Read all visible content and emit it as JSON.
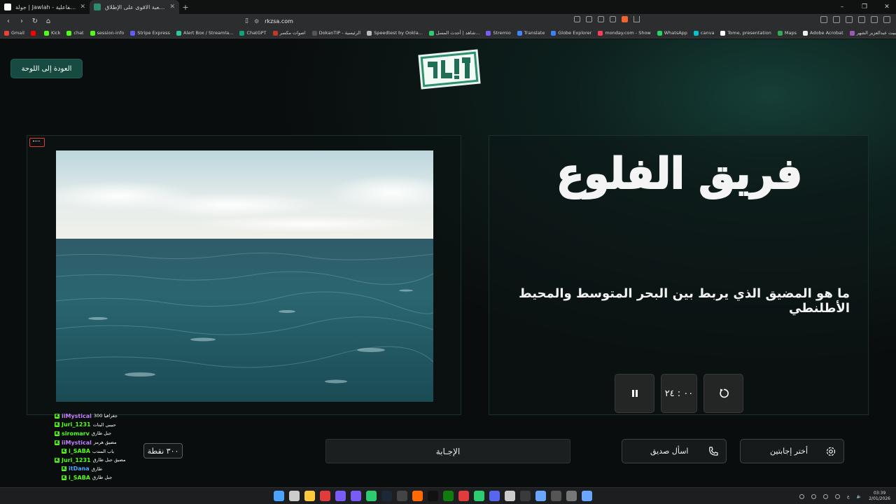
{
  "browser": {
    "tabs": [
      {
        "title": "جولة | Jawlah - منصة الألعاب التفاعلية",
        "active": false,
        "favicon_color": "#ffffff"
      },
      {
        "title": "ركز - اللعبة الاقوى على الإطلاق",
        "active": true,
        "favicon_color": "#2e8b6b"
      }
    ],
    "new_tab": "+",
    "window_controls": [
      "–",
      "❐",
      "✕"
    ],
    "url": "rkzsa.com",
    "bookmarks": [
      {
        "label": "Gmail",
        "color": "#ea4335"
      },
      {
        "label": "",
        "color": "#ff0000"
      },
      {
        "label": "Kick",
        "color": "#53fc18"
      },
      {
        "label": "chat",
        "color": "#53fc18"
      },
      {
        "label": "session-info",
        "color": "#53fc18"
      },
      {
        "label": "Stripe Express",
        "color": "#635bff"
      },
      {
        "label": "Alert Box / Streamla...",
        "color": "#31c3a2"
      },
      {
        "label": "ChatGPT",
        "color": "#10a37f"
      },
      {
        "label": "اصوات مكسر",
        "color": "#c0392b"
      },
      {
        "label": "DokanTIP - الرئيسية",
        "color": "#555555"
      },
      {
        "label": "Speedtest by Ookla...",
        "color": "#bbbbbb"
      },
      {
        "label": "شاهد | أحدث المسل...",
        "color": "#2ecc71"
      },
      {
        "label": "Stremio",
        "color": "#7b5bf5"
      },
      {
        "label": "Translate",
        "color": "#4285f4"
      },
      {
        "label": "Globe Explorer",
        "color": "#3b82f6"
      },
      {
        "label": "monday.com - Show",
        "color": "#ff3d57"
      },
      {
        "label": "WhatsApp",
        "color": "#25d366"
      },
      {
        "label": "canva",
        "color": "#00c4cc"
      },
      {
        "label": "Tome, presentation",
        "color": "#ffffff"
      },
      {
        "label": "Maps",
        "color": "#34a853"
      },
      {
        "label": "Adobe Acrobat",
        "color": "#eeeeee"
      },
      {
        "label": "البيت عبدالعزيز الشهر...",
        "color": "#9b59b6"
      }
    ]
  },
  "page": {
    "back_button": "العودة إلى اللوحة",
    "logo_text": "ركز!",
    "team_name": "فريق الفلوع",
    "question": "ما هو المضيق الذي يربط بين البحر المتوسط والمحيط الأطلنطي",
    "timer": "٠٠ : ٢٤",
    "answer_label": "الإجـابة",
    "ask_friend_label": "اسأل صديق",
    "two_answers_label": "أختر إجابتين",
    "score": "٣٠٠ نقطة"
  },
  "chat": [
    {
      "user": "iiMystical",
      "color": "#c77dff",
      "msg": "جغرافيا 300",
      "indent": 0
    },
    {
      "user": "Juri_1231",
      "color": "#53fc18",
      "msg": "حبيبي البنات",
      "indent": 0
    },
    {
      "user": "siromarv",
      "color": "#53fc18",
      "msg": "جبل طارق",
      "indent": 0
    },
    {
      "user": "iiMystical",
      "color": "#c77dff",
      "msg": "مضيق هرمز",
      "indent": 0
    },
    {
      "user": "i_SABA",
      "color": "#53fc18",
      "msg": "باب المندب",
      "indent": 10
    },
    {
      "user": "Juri_1231",
      "color": "#53fc18",
      "msg": "مضيق جبل طارق",
      "indent": 0
    },
    {
      "user": "itDana",
      "color": "#4fa3ff",
      "msg": "طارق",
      "indent": 10
    },
    {
      "user": "i_SABA",
      "color": "#53fc18",
      "msg": "جبل طارق",
      "indent": 10
    }
  ],
  "taskbar": {
    "icon_colors": [
      "#4aa3ff",
      "#cccccc",
      "#ffc83d",
      "#e23b3b",
      "#7b5bf5",
      "#7b5bf5",
      "#2ecc71",
      "#1b2838",
      "#444444",
      "#ff6b00",
      "#111111",
      "#107c10",
      "#e23b3b",
      "#2ecc71",
      "#5865f2",
      "#cccccc",
      "#3a3a3a",
      "#6aa6ff",
      "#555555",
      "#777777",
      "#6aa6ff"
    ],
    "lang": "ع",
    "time": "03:39",
    "date": "2/01/2026"
  }
}
